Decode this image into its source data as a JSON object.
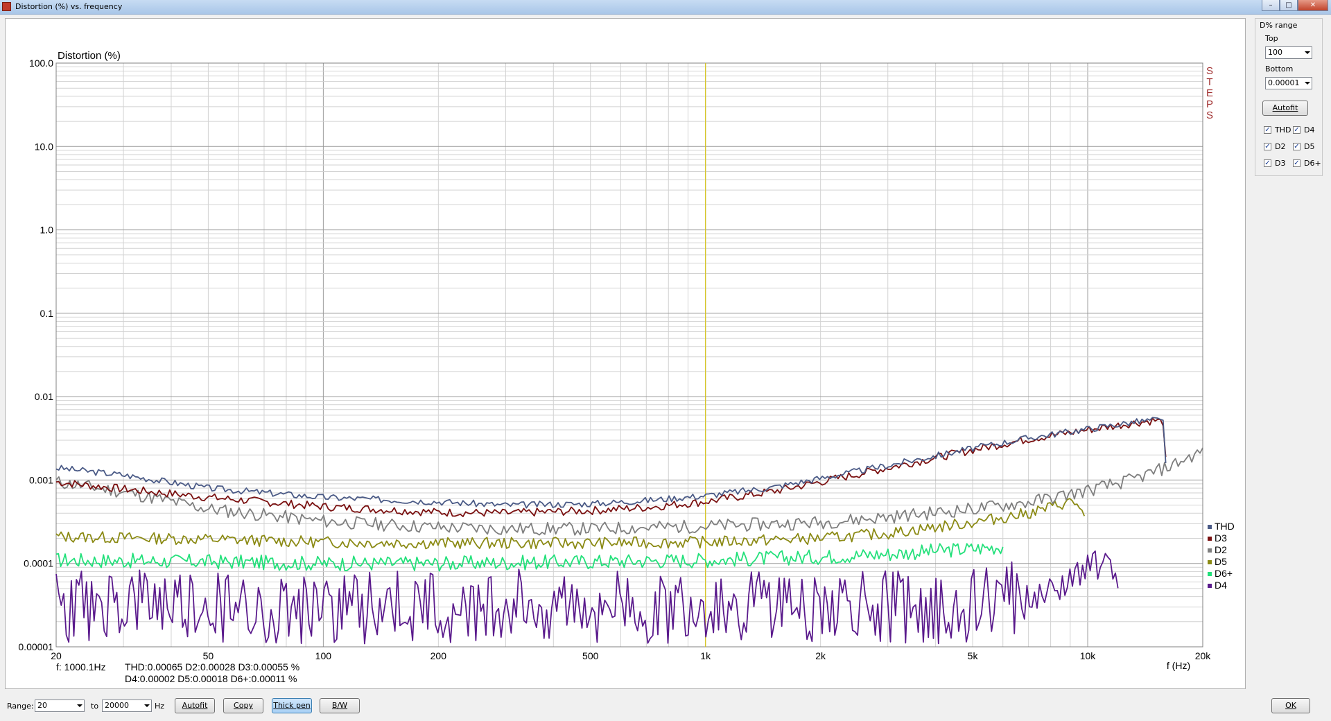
{
  "window": {
    "title": "Distortion (%) vs. frequency"
  },
  "controls": {
    "group_title": "D% range",
    "top_label": "Top",
    "top_value": "100",
    "bottom_label": "Bottom",
    "bottom_value": "0.00001",
    "autofit": "Autofit",
    "checkboxes": [
      {
        "label": "THD",
        "checked": true
      },
      {
        "label": "D4",
        "checked": true
      },
      {
        "label": "D2",
        "checked": true
      },
      {
        "label": "D5",
        "checked": true
      },
      {
        "label": "D3",
        "checked": true
      },
      {
        "label": "D6+",
        "checked": true
      }
    ]
  },
  "bottom_bar": {
    "range_label": "Range:",
    "range_from": "20",
    "to_label": "to",
    "range_to": "20000",
    "unit": "Hz",
    "autofit": "Autofit",
    "copy": "Copy",
    "thick_pen": "Thick pen",
    "bw": "B/W",
    "ok": "OK"
  },
  "readout": {
    "f": "f: 1000.1Hz",
    "line1": "THD:0.00065   D2:0.00028   D3:0.00055 %",
    "line2": "D4:0.00002   D5:0.00018   D6+:0.00011 %"
  },
  "chart_data": {
    "type": "line",
    "title": "",
    "ylabel": "Distortion (%)",
    "xlabel": "f (Hz)",
    "x_scale": "log",
    "y_scale": "log",
    "xlim": [
      20,
      20000
    ],
    "ylim": [
      1e-05,
      100
    ],
    "x_ticks": [
      20,
      50,
      100,
      200,
      500,
      1000,
      2000,
      5000,
      10000,
      20000
    ],
    "x_tick_labels": [
      "20",
      "50",
      "100",
      "200",
      "500",
      "1k",
      "2k",
      "5k",
      "10k",
      "20k"
    ],
    "y_ticks": [
      1e-05,
      0.0001,
      0.001,
      0.01,
      0.1,
      1,
      10,
      100
    ],
    "y_tick_labels": [
      "0.00001",
      "0.0001",
      "0.001",
      "0.01",
      "0.1",
      "1.0",
      "10.0",
      "100.0"
    ],
    "grid": true,
    "cursor_x": 1000,
    "side_text": "STEPS",
    "legend_position": "bottom-right",
    "series": [
      {
        "name": "THD",
        "color": "#4a5a86",
        "x": [
          20,
          30,
          50,
          100,
          200,
          300,
          500,
          700,
          1000,
          1500,
          2000,
          3000,
          5000,
          7000,
          10000,
          13000,
          15000,
          15800,
          16000
        ],
        "y": [
          0.0014,
          0.00115,
          0.0008,
          0.00062,
          0.00055,
          0.0005,
          0.00052,
          0.00057,
          0.00065,
          0.00082,
          0.00105,
          0.0015,
          0.0024,
          0.0032,
          0.0041,
          0.0049,
          0.0053,
          0.005,
          0.0017
        ]
      },
      {
        "name": "D6+",
        "color": "#22e07a",
        "x": [
          20,
          50,
          100,
          200,
          500,
          1000,
          2000,
          3000,
          5000,
          6000
        ],
        "y": [
          0.00011,
          0.000105,
          0.0001,
          0.0001,
          0.000105,
          0.00011,
          0.00012,
          0.00013,
          0.00015,
          0.00016
        ]
      },
      {
        "name": "D5",
        "color": "#8b8a14",
        "x": [
          20,
          50,
          100,
          200,
          500,
          1000,
          2000,
          3000,
          5000,
          7000,
          9000,
          9500,
          9800
        ],
        "y": [
          0.00021,
          0.000195,
          0.00018,
          0.000175,
          0.000175,
          0.00018,
          0.0002,
          0.00023,
          0.00031,
          0.0004,
          0.00055,
          0.0005,
          0.00035
        ]
      },
      {
        "name": "D4",
        "color": "#5a1a8c",
        "x": [
          20,
          100,
          500,
          1000,
          3000,
          5000,
          6000,
          8000,
          10000,
          11000,
          12000
        ],
        "y": [
          2e-05,
          2e-05,
          2e-05,
          2e-05,
          2e-05,
          2e-05,
          2.2e-05,
          4.5e-05,
          9e-05,
          0.0001,
          7e-05
        ]
      },
      {
        "name": "D3",
        "color": "#7a1010",
        "x": [
          20,
          30,
          50,
          100,
          200,
          300,
          500,
          700,
          1000,
          1500,
          2000,
          3000,
          5000,
          7000,
          10000,
          13000,
          15000,
          15800,
          16000
        ],
        "y": [
          0.00095,
          0.00078,
          0.00062,
          0.00048,
          0.00041,
          0.0004,
          0.00043,
          0.00047,
          0.00055,
          0.00073,
          0.00095,
          0.0014,
          0.0023,
          0.0031,
          0.004,
          0.0048,
          0.0052,
          0.0049,
          0.0017
        ]
      },
      {
        "name": "D2",
        "color": "#7e7e7e",
        "x": [
          20,
          30,
          50,
          100,
          200,
          300,
          500,
          1000,
          2000,
          3000,
          5000,
          7000,
          10000,
          13000,
          16000,
          20000
        ],
        "y": [
          0.00095,
          0.00072,
          0.00045,
          0.00032,
          0.00027,
          0.00026,
          0.00026,
          0.00028,
          0.00031,
          0.00036,
          0.00045,
          0.00054,
          0.00075,
          0.001,
          0.0014,
          0.0022
        ]
      }
    ]
  }
}
